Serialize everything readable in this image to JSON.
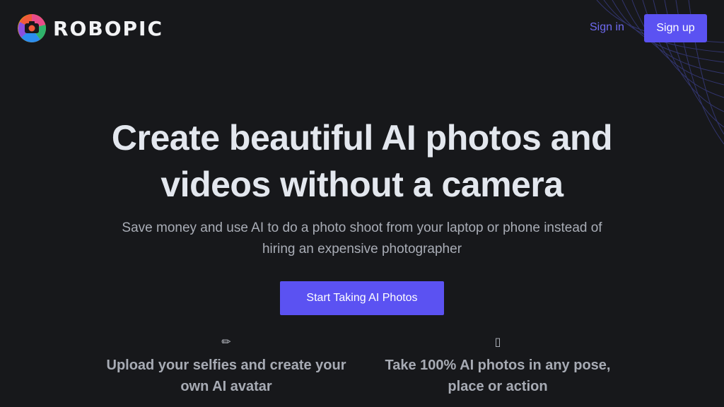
{
  "header": {
    "brand": "ROBOPIC",
    "signin_label": "Sign in",
    "signup_label": "Sign up"
  },
  "hero": {
    "title_line1": "Create beautiful AI photos and",
    "title_line2": "videos without a camera",
    "subtitle_line1": "Save money and use AI to do a photo shoot from your laptop or phone instead of",
    "subtitle_line2": "hiring an expensive photographer",
    "cta_label": "Start Taking AI Photos"
  },
  "features": [
    {
      "icon": "pencil-icon",
      "glyph": "✏",
      "line1": "Upload your selfies and create your",
      "line2": "own AI avatar"
    },
    {
      "icon": "camera-icon",
      "glyph": "▯",
      "line1": "Take 100% AI photos in any pose,",
      "line2": "place or action"
    }
  ],
  "colors": {
    "background": "#17181b",
    "accent": "#5b52f2",
    "link": "#6e6af0"
  }
}
